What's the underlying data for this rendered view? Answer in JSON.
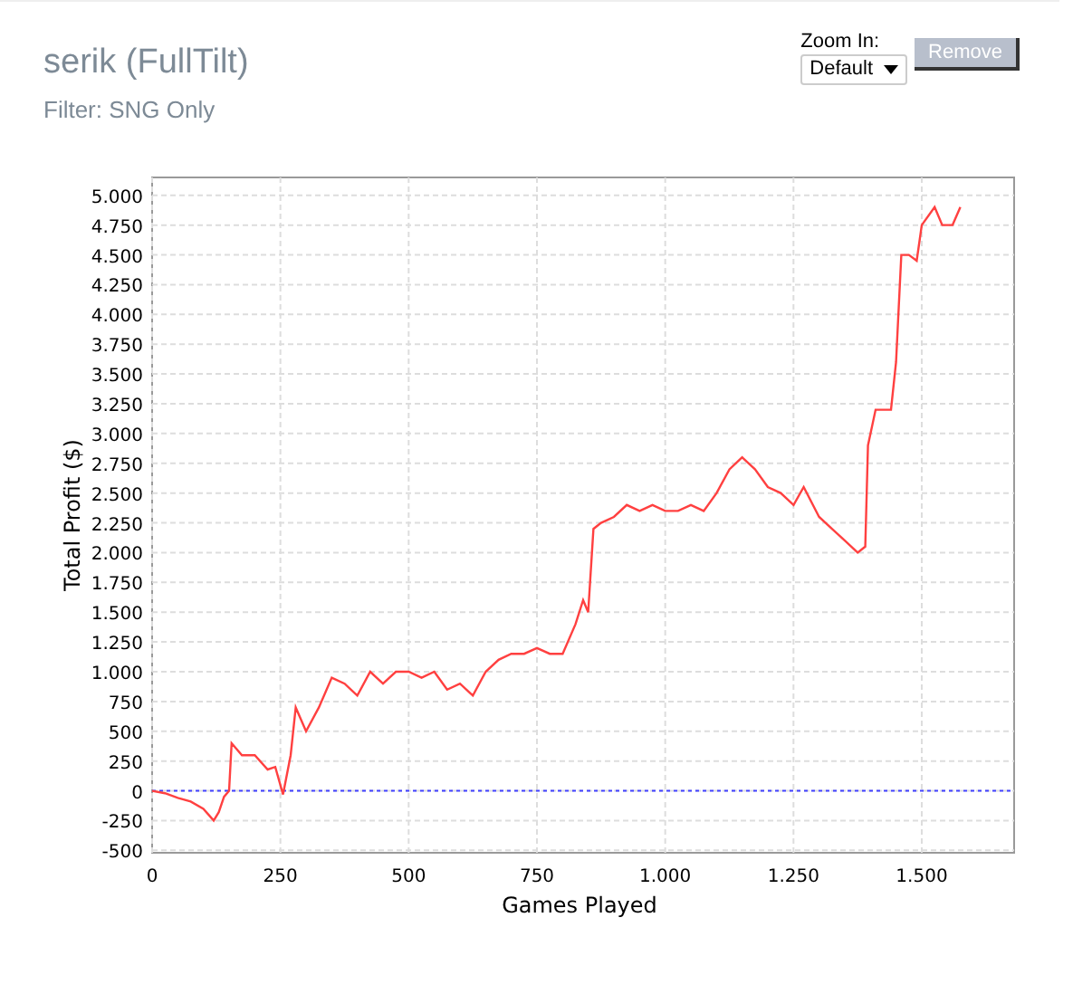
{
  "header": {
    "title": "serik (FullTilt)",
    "filter": "Filter: SNG Only"
  },
  "zoom": {
    "label": "Zoom In:",
    "value": "Default"
  },
  "remove_button": {
    "label": "Remove",
    "disabled": true
  },
  "chart_data": {
    "type": "line",
    "xlabel": "Games Played",
    "ylabel": "Total Profit ($)",
    "xlim": [
      0,
      1680
    ],
    "ylim": [
      -520,
      5150
    ],
    "xticks": [
      {
        "value": 0,
        "label": "0"
      },
      {
        "value": 250,
        "label": "250"
      },
      {
        "value": 500,
        "label": "500"
      },
      {
        "value": 750,
        "label": "750"
      },
      {
        "value": 1000,
        "label": "1.000"
      },
      {
        "value": 1250,
        "label": "1.250"
      },
      {
        "value": 1500,
        "label": "1.500"
      }
    ],
    "yticks": [
      {
        "value": -500,
        "label": "-500"
      },
      {
        "value": -250,
        "label": "-250"
      },
      {
        "value": 0,
        "label": "0"
      },
      {
        "value": 250,
        "label": "250"
      },
      {
        "value": 500,
        "label": "500"
      },
      {
        "value": 750,
        "label": "750"
      },
      {
        "value": 1000,
        "label": "1.000"
      },
      {
        "value": 1250,
        "label": "1.250"
      },
      {
        "value": 1500,
        "label": "1.500"
      },
      {
        "value": 1750,
        "label": "1.750"
      },
      {
        "value": 2000,
        "label": "2.000"
      },
      {
        "value": 2250,
        "label": "2.250"
      },
      {
        "value": 2500,
        "label": "2.500"
      },
      {
        "value": 2750,
        "label": "2.750"
      },
      {
        "value": 3000,
        "label": "3.000"
      },
      {
        "value": 3250,
        "label": "3.250"
      },
      {
        "value": 3500,
        "label": "3.500"
      },
      {
        "value": 3750,
        "label": "3.750"
      },
      {
        "value": 4000,
        "label": "4.000"
      },
      {
        "value": 4250,
        "label": "4.250"
      },
      {
        "value": 4500,
        "label": "4.500"
      },
      {
        "value": 4750,
        "label": "4.750"
      },
      {
        "value": 5000,
        "label": "5.000"
      }
    ],
    "x": [
      0,
      25,
      50,
      75,
      100,
      120,
      130,
      140,
      150,
      155,
      175,
      200,
      225,
      240,
      255,
      270,
      280,
      300,
      325,
      350,
      375,
      400,
      425,
      450,
      475,
      500,
      525,
      550,
      575,
      600,
      625,
      650,
      675,
      700,
      725,
      750,
      775,
      800,
      825,
      840,
      850,
      860,
      875,
      900,
      925,
      950,
      975,
      1000,
      1025,
      1050,
      1075,
      1100,
      1125,
      1150,
      1175,
      1200,
      1225,
      1250,
      1270,
      1300,
      1325,
      1350,
      1375,
      1390,
      1395,
      1410,
      1425,
      1440,
      1450,
      1460,
      1475,
      1490,
      1500,
      1525,
      1540,
      1560,
      1575
    ],
    "series": [
      {
        "color": "#ff4040",
        "values": [
          0,
          -20,
          -60,
          -90,
          -150,
          -250,
          -180,
          -50,
          0,
          400,
          300,
          300,
          180,
          200,
          -30,
          300,
          700,
          500,
          700,
          950,
          900,
          800,
          1000,
          900,
          1000,
          1000,
          950,
          1000,
          850,
          900,
          800,
          1000,
          1100,
          1150,
          1150,
          1200,
          1150,
          1150,
          1400,
          1600,
          1500,
          2200,
          2250,
          2300,
          2400,
          2350,
          2400,
          2350,
          2350,
          2400,
          2350,
          2500,
          2700,
          2800,
          2700,
          2550,
          2500,
          2400,
          2550,
          2300,
          2200,
          2100,
          2000,
          2050,
          2900,
          3200,
          3200,
          3200,
          3600,
          4500,
          4500,
          4450,
          4750,
          4900,
          4750,
          4750,
          4900
        ]
      }
    ],
    "grid": true,
    "ref_lines": [
      {
        "axis": "y",
        "value": 0,
        "color": "#4040ff"
      }
    ]
  }
}
